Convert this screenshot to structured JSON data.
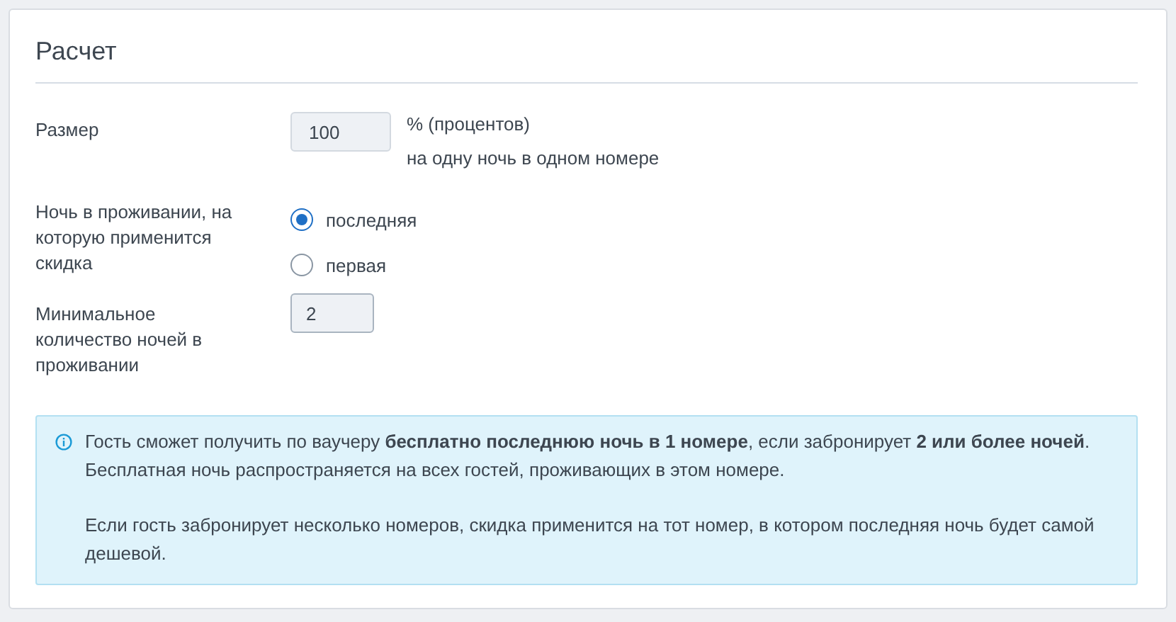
{
  "section": {
    "title": "Расчет"
  },
  "fields": [
    {
      "kind": "number",
      "label": "Размер",
      "value": "100",
      "unit": "% (процентов)",
      "note": "на одну ночь в одном номере"
    },
    {
      "kind": "radio",
      "label": "Ночь в проживании, на которую применится скидка",
      "options": [
        {
          "label": "последняя",
          "selected": true
        },
        {
          "label": "первая",
          "selected": false
        }
      ]
    },
    {
      "kind": "number",
      "label": "Минимальное количество ночей в проживании",
      "value": "2"
    }
  ],
  "info": {
    "paragraphs": [
      "Гость сможет получить по ваучеру **бесплатно последнюю ночь в 1 номере**, если забронирует **2 или более ночей**. Бесплатная ночь распространяется на всех гостей, проживающих в этом номере.",
      "Если гость забронирует несколько номеров, скидка применится на тот номер, в котором последняя ночь будет самой дешевой."
    ]
  }
}
